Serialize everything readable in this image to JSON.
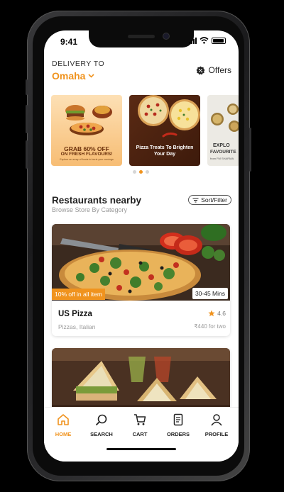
{
  "status_bar": {
    "time": "9:41"
  },
  "header": {
    "delivery_label": "DELIVERY TO",
    "location": "Omaha",
    "offers_label": "Offers"
  },
  "banners": [
    {
      "headline": "GRAB 60% OFF",
      "subline": "ON FRESH FLAVOURS!",
      "caption": "Explore an array of foods to burst your cravings"
    },
    {
      "headline": "Pizza Treats To Brighten Your Day"
    },
    {
      "headline": "EXPLO",
      "subline": "FAVOURITE",
      "caption": "from FM SHARMA"
    }
  ],
  "carousel": {
    "active_index": 1,
    "count": 3
  },
  "restaurants_section": {
    "title": "Restaurants nearby",
    "subtitle": "Browse Store By Category",
    "sort_label": "Sort/Filter"
  },
  "restaurants": [
    {
      "promo": "10% off in all item",
      "eta": "30-45 Mins",
      "name": "US Pizza",
      "rating": "4.6",
      "cuisine": "Pizzas, Italian",
      "price": "₹440 for two"
    }
  ],
  "tabbar": {
    "items": [
      {
        "label": "HOME",
        "icon": "home-icon",
        "active": true
      },
      {
        "label": "SEARCH",
        "icon": "search-icon"
      },
      {
        "label": "CART",
        "icon": "cart-icon"
      },
      {
        "label": "ORDERS",
        "icon": "orders-icon"
      },
      {
        "label": "PROFILE",
        "icon": "profile-icon"
      }
    ]
  },
  "colors": {
    "accent": "#f0931e",
    "text": "#222222",
    "muted": "#999999"
  }
}
